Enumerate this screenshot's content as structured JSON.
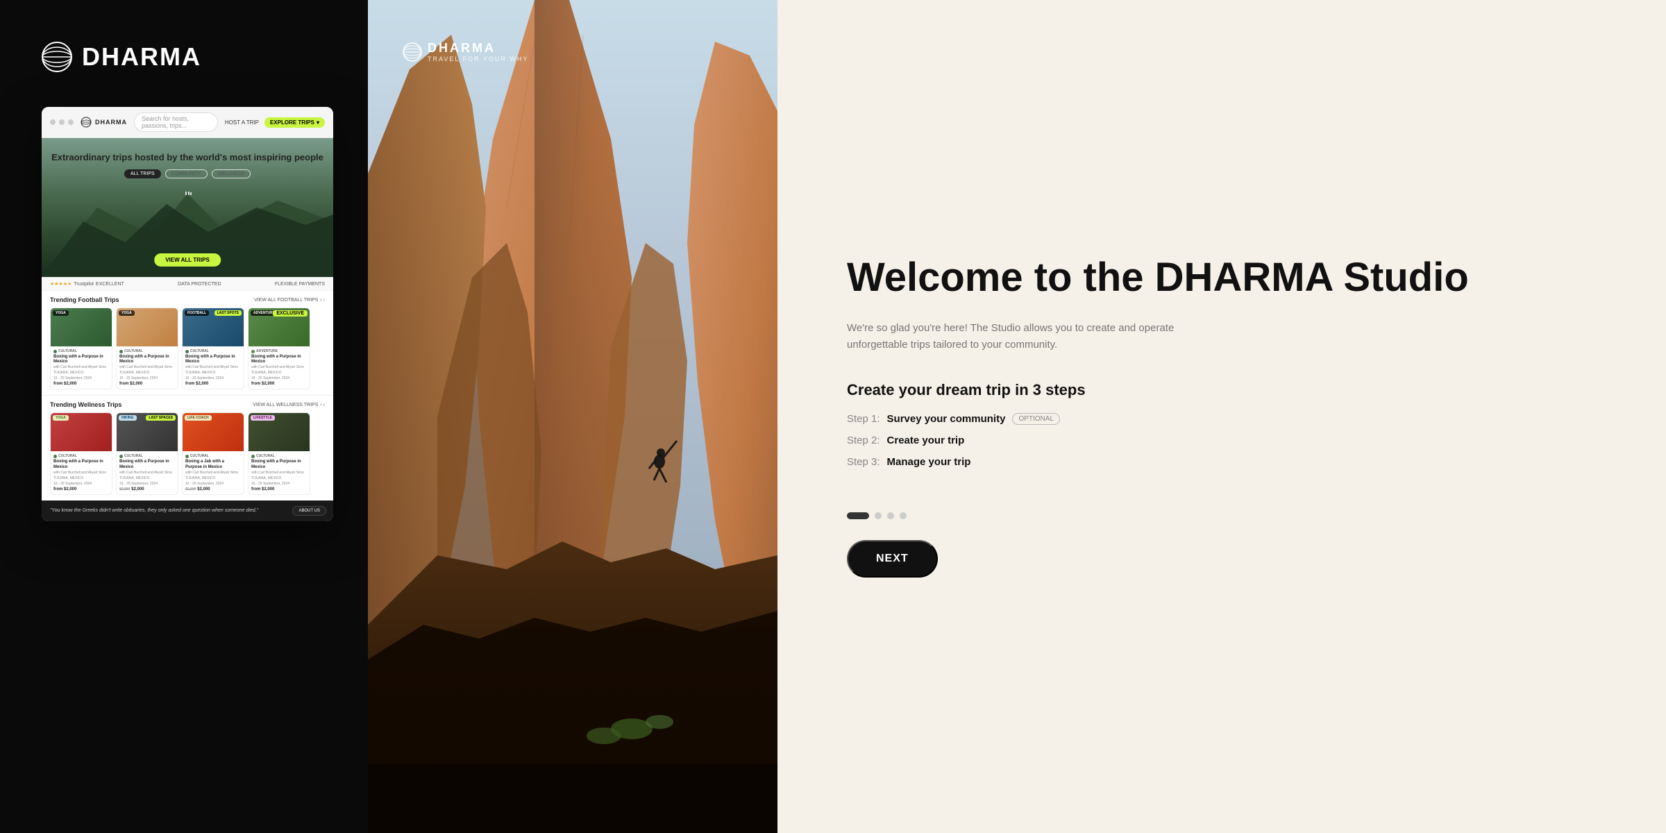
{
  "brand": {
    "name": "DHARMA",
    "tagline": "TRAVEL FOR YOUR WHY"
  },
  "left_panel": {
    "browser": {
      "search_placeholder": "Search for hosts, passions, trips...",
      "nav_host": "HOST A TRIP",
      "nav_explore": "EXPLORE TRIPS"
    },
    "hero": {
      "title": "Extraordinary trips hosted by the world's most inspiring people",
      "filter_tabs": [
        "ALL TRIPS",
        "COMMUNITY",
        "WELLNESS"
      ],
      "view_all_btn": "VIEW ALL TRIPS"
    },
    "trust": {
      "rating": "Trustpilot",
      "stars": "★★★★★",
      "label": "EXCELLENT",
      "protection": "DATA PROTECTED",
      "payment": "FLEXIBLE PAYMENTS"
    },
    "football_section": {
      "title": "Trending Football Trips",
      "view_all": "VIEW ALL FOOTBALL TRIPS",
      "cards": [
        {
          "badge": "YOGA",
          "name": "Boxing with a Purpose in Mexico",
          "host": "with Carl Burchell and Aliyah Sims",
          "location": "TIJUANA, MEXICO",
          "dates": "16 - 20 September, 2024",
          "price": "$2,000",
          "category": "CULTURAL"
        },
        {
          "badge": "YOGA",
          "name": "Boxing with a Purpose in Mexico",
          "host": "with Carl Burchell and Aliyah Sims",
          "location": "TIJUANA, MEXICO",
          "dates": "16 - 20 September, 2024",
          "price": "$2,000",
          "category": "CULTURAL"
        },
        {
          "badge": "FOOTBALL",
          "name": "Boxing with a Purpose in Mexico",
          "host": "with Carl Burchell and Aliyah Sims",
          "location": "TIJUANA, MEXICO",
          "dates": "16 - 20 September, 2024",
          "price": "$2,000",
          "category": "CULTURAL",
          "last_spots": "LAST SPOTS"
        },
        {
          "badge": "ADVENTURE",
          "name": "Boxing with a Purpose in Mexico",
          "host": "with Carl Burchell and Aliyah Sims",
          "location": "TIJUANA, MEXICO",
          "dates": "16 - 20 September, 2024",
          "price": "$2,000",
          "category": "ADVENTURE",
          "exclusive": "EXCLUSIVE"
        }
      ]
    },
    "wellness_section": {
      "title": "Trending Wellness Trips",
      "view_all": "VIEW ALL WELLNESS TRIPS",
      "cards": [
        {
          "badge": "YOGA",
          "name": "Boxing with a Purpose in Mexico",
          "host": "with Carl Burchell and Aliyah Sims",
          "location": "TIJUANA, MEXICO",
          "dates": "16 - 20 September, 2024",
          "price": "$2,000",
          "category": "CULTURAL"
        },
        {
          "badge": "HIKING",
          "name": "Boxing with a Purpose in Mexico",
          "host": "with Carl Burchell and Aliyah Sims",
          "location": "TIJUANA, MEXICO",
          "dates": "16 - 20 September, 2024",
          "price": "$2,000",
          "old_price": "$2,200",
          "category": "CULTURAL",
          "last_spots": "LAST SPACES"
        },
        {
          "badge": "LIFE COACH",
          "name": "Boxing a Jab with a Purpose in Mexico",
          "host": "with Carl Burchell and Aliyah Sims",
          "location": "TIJUANA, MEXICO",
          "dates": "16 - 20 September, 2024",
          "price": "$2,000",
          "old_price": "$2,200",
          "category": "CULTURAL"
        },
        {
          "badge": "LIFESTYLE",
          "name": "Boxing with a Purpose in Mexico",
          "host": "with Carl Burchell and Aliyah Sims",
          "location": "TIJUANA, MEXICO",
          "dates": "16 - 20 September, 2024",
          "price": "$2,000",
          "category": "CULTURAL"
        }
      ]
    },
    "quote": {
      "text": "\"You know the Greeks didn't write obituaries, they only asked one question when someone died,\"",
      "about_btn": "ABOUT US"
    }
  },
  "right_panel": {
    "welcome_title": "Welcome to the DHARMA Studio",
    "description": "We're so glad you're here! The Studio allows you to create and operate unforgettable trips tailored to your community.",
    "steps_title": "Create your dream trip in 3 steps",
    "steps": [
      {
        "label": "Step 1:",
        "value": "Survey your community",
        "badge": "OPTIONAL"
      },
      {
        "label": "Step 2:",
        "value": "Create your trip"
      },
      {
        "label": "Step 3:",
        "value": "Manage your trip"
      }
    ],
    "next_button": "NEXT",
    "pagination": {
      "total": 4,
      "active": 0
    }
  }
}
